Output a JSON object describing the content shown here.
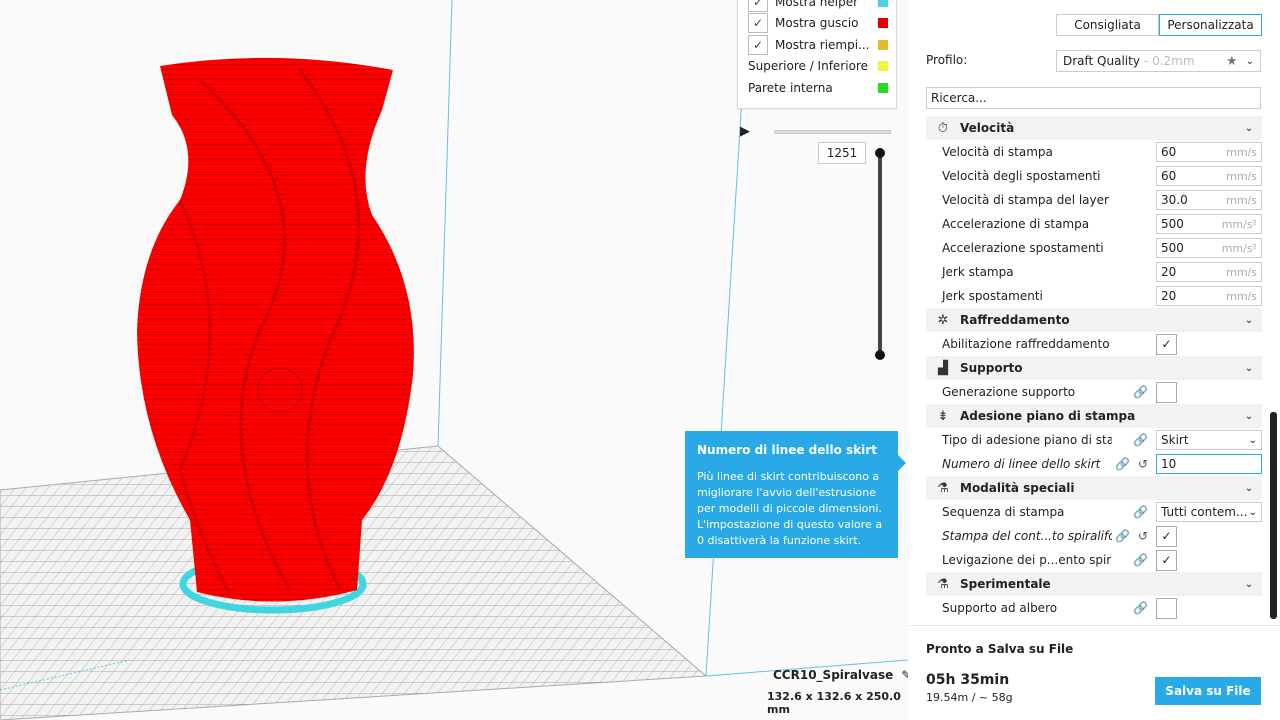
{
  "legend": {
    "items": [
      {
        "label": "Mostra helper",
        "checked": true,
        "color": "#4dd0e1"
      },
      {
        "label": "Mostra guscio",
        "checked": true,
        "color": "#e00000"
      },
      {
        "label": "Mostra riempi...",
        "checked": true,
        "color": "#e8b830"
      },
      {
        "label": "Superiore / Inferiore",
        "checked": false,
        "color": "#f2f247"
      },
      {
        "label": "Parete interna",
        "checked": false,
        "color": "#22dd22"
      }
    ],
    "check_glyph": "✓"
  },
  "layer_slider": {
    "play_glyph": "▶",
    "current_layer": "1251"
  },
  "tooltip": {
    "title": "Numero di linee dello skirt",
    "body": "Più linee di skirt contribuiscono a migliorare l'avvio dell'estrusione per modelli di piccole dimensioni. L'impostazione di questo valore a 0 disattiverà la funzione skirt."
  },
  "object": {
    "name": "CCR10_Spiralvase",
    "edit_glyph": "✎",
    "dimensions": "132.6 x 132.6 x 250.0 mm"
  },
  "sidebar": {
    "modes": [
      {
        "label": "Consigliata",
        "active": false
      },
      {
        "label": "Personalizzata",
        "active": true
      }
    ],
    "profile_label": "Profilo:",
    "profile_value": "Draft Quality",
    "profile_sub": "- 0.2mm",
    "star_glyph": "★",
    "chevron_glyph": "⌄",
    "search_placeholder": "Ricerca...",
    "link_glyph": "🔗",
    "reset_glyph": "↺",
    "rows": [
      {
        "kind": "category",
        "label": "Velocità",
        "icon": "⏱",
        "iconName": "speed-icon"
      },
      {
        "kind": "setting",
        "label": "Velocità di stampa",
        "value": "60",
        "unit": "mm/s"
      },
      {
        "kind": "setting",
        "label": "Velocità degli spostamenti",
        "value": "60",
        "unit": "mm/s"
      },
      {
        "kind": "setting",
        "label": "Velocità di stampa del layer iniziale",
        "value": "30.0",
        "unit": "mm/s"
      },
      {
        "kind": "setting",
        "label": "Accelerazione di stampa",
        "value": "500",
        "unit": "mm/s²"
      },
      {
        "kind": "setting",
        "label": "Accelerazione spostamenti",
        "value": "500",
        "unit": "mm/s²"
      },
      {
        "kind": "setting",
        "label": "Jerk stampa",
        "value": "20",
        "unit": "mm/s"
      },
      {
        "kind": "setting",
        "label": "Jerk spostamenti",
        "value": "20",
        "unit": "mm/s"
      },
      {
        "kind": "category",
        "label": "Raffreddamento",
        "icon": "✲",
        "iconName": "fan-icon"
      },
      {
        "kind": "checkbox",
        "label": "Abilitazione raffreddamento stampa",
        "checked": true
      },
      {
        "kind": "category",
        "label": "Supporto",
        "icon": "▟",
        "iconName": "support-icon"
      },
      {
        "kind": "checkbox",
        "label": "Generazione supporto",
        "checked": false,
        "link": true
      },
      {
        "kind": "category",
        "label": "Adesione piano di stampa",
        "icon": "⇟",
        "iconName": "adhesion-icon"
      },
      {
        "kind": "dropdown",
        "label": "Tipo di adesione piano di stampa",
        "value": "Skirt",
        "link": true
      },
      {
        "kind": "setting",
        "label": "Numero di linee dello skirt",
        "value": "10",
        "unit": "",
        "italic": true,
        "link": true,
        "reset": true,
        "focus": true
      },
      {
        "kind": "category",
        "label": "Modalità speciali",
        "icon": "⚗",
        "iconName": "special-modes-icon"
      },
      {
        "kind": "dropdown",
        "label": "Sequenza di stampa",
        "value": "Tutti contem...",
        "link": true
      },
      {
        "kind": "checkbox",
        "label": "Stampa del cont...to spiraliforme",
        "checked": true,
        "italic": true,
        "link": true,
        "reset": true
      },
      {
        "kind": "checkbox",
        "label": "Levigazione dei p...ento spiraliforme",
        "checked": true,
        "link": true
      },
      {
        "kind": "category",
        "label": "Sperimentale",
        "icon": "⚗",
        "iconName": "experimental-icon"
      },
      {
        "kind": "checkbox",
        "label": "Supporto ad albero",
        "checked": false,
        "link": true
      }
    ]
  },
  "footer": {
    "status": "Pronto a Salva su File",
    "time": "05h 35min",
    "material": "19.54m / ~ 58g",
    "save_label": "Salva su File"
  },
  "colors": {
    "accent": "#29a9e6",
    "model": "#ff0000",
    "skirt": "#3fd6e0"
  }
}
